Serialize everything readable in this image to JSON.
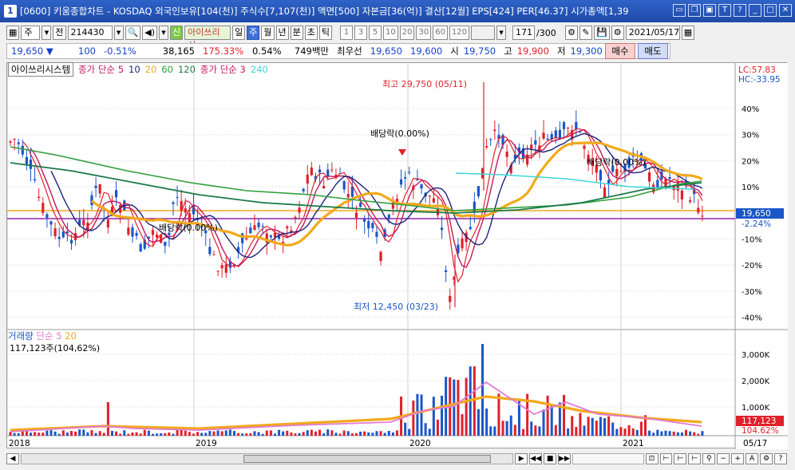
{
  "window": {
    "number": "1",
    "title": "[0600] 키움종합차트 - KOSDAQ 외국인보유[104(천)] 주식수[7,107(천)] 액면[500] 자본금[36(억)] 결산[12월] EPS[424] PER[46.37] 시가총액[1,39"
  },
  "toolbar1": {
    "period_type": "주",
    "prev": "전",
    "code": "214430",
    "signal_label": "신",
    "system_name": "아이쓰리시",
    "period_buttons": [
      "일",
      "주",
      "월",
      "년",
      "분",
      "초",
      "틱"
    ],
    "selected_period": "주",
    "minute_values": [
      "1",
      "3",
      "5",
      "10",
      "20",
      "30",
      "60",
      "120"
    ],
    "count": "171",
    "total": "/300",
    "date": "2021/05/17"
  },
  "quote": {
    "price": "19,650",
    "change": "100",
    "change_pct": "-0.51%",
    "volume": "38,165",
    "vol_ratio": "175.33%",
    "turnover": "0.54%",
    "amount": "749백만",
    "best_label": "최우선",
    "best_ask": "19,650",
    "best_bid": "19,600",
    "open_label": "시",
    "open": "19,750",
    "high_label": "고",
    "high": "19,900",
    "low_label": "저",
    "low": "19,300",
    "buy": "매수",
    "sell": "매도"
  },
  "legend": {
    "system": "아이쓰리시스템",
    "ma_label": "종가 단순 5",
    "ma10": "10",
    "ma20": "20",
    "ma60": "60",
    "ma120": "120",
    "ma2_label": "종가 단순 3",
    "ma240": "240"
  },
  "volume_legend": {
    "label": "거래량",
    "ma_label": "단순 5",
    "ma20": "20",
    "current": "117,123주(104,62%)"
  },
  "right_axis": {
    "lc": "LC:57.83",
    "hc": "HC:-33.95",
    "price_tag": "19,650",
    "price_pct": "-2.24%",
    "vol_tag": "117,123",
    "vol_pct": "104.62%",
    "date_tag": "05/17"
  },
  "annotations": {
    "high": "최고 29,750 (05/11)",
    "low": "최저 12,450 (03/23)",
    "div1": "배당락(0.00%)",
    "div2": "배당락(0.00%)",
    "div3": "배당락(0.00%)"
  },
  "colors": {
    "up": "#e0202a",
    "down": "#1a56c8",
    "ma5": "#c2185b",
    "ma10": "#1a237e",
    "ma20": "#f2a91b",
    "ma60": "#2e9e3a",
    "ma120": "#1a7a4a",
    "ma240": "#3fd6d6"
  },
  "chart_data": {
    "type": "candlestick",
    "y_pct_ticks": [
      "40%",
      "30%",
      "20%",
      "10%",
      "0%",
      "-10%",
      "-20%",
      "-30%",
      "-40%"
    ],
    "vol_ticks": [
      "3,000K",
      "2,000K",
      "1,000K"
    ],
    "x_labels": [
      "2018",
      "2019",
      "2020",
      "2021"
    ]
  }
}
